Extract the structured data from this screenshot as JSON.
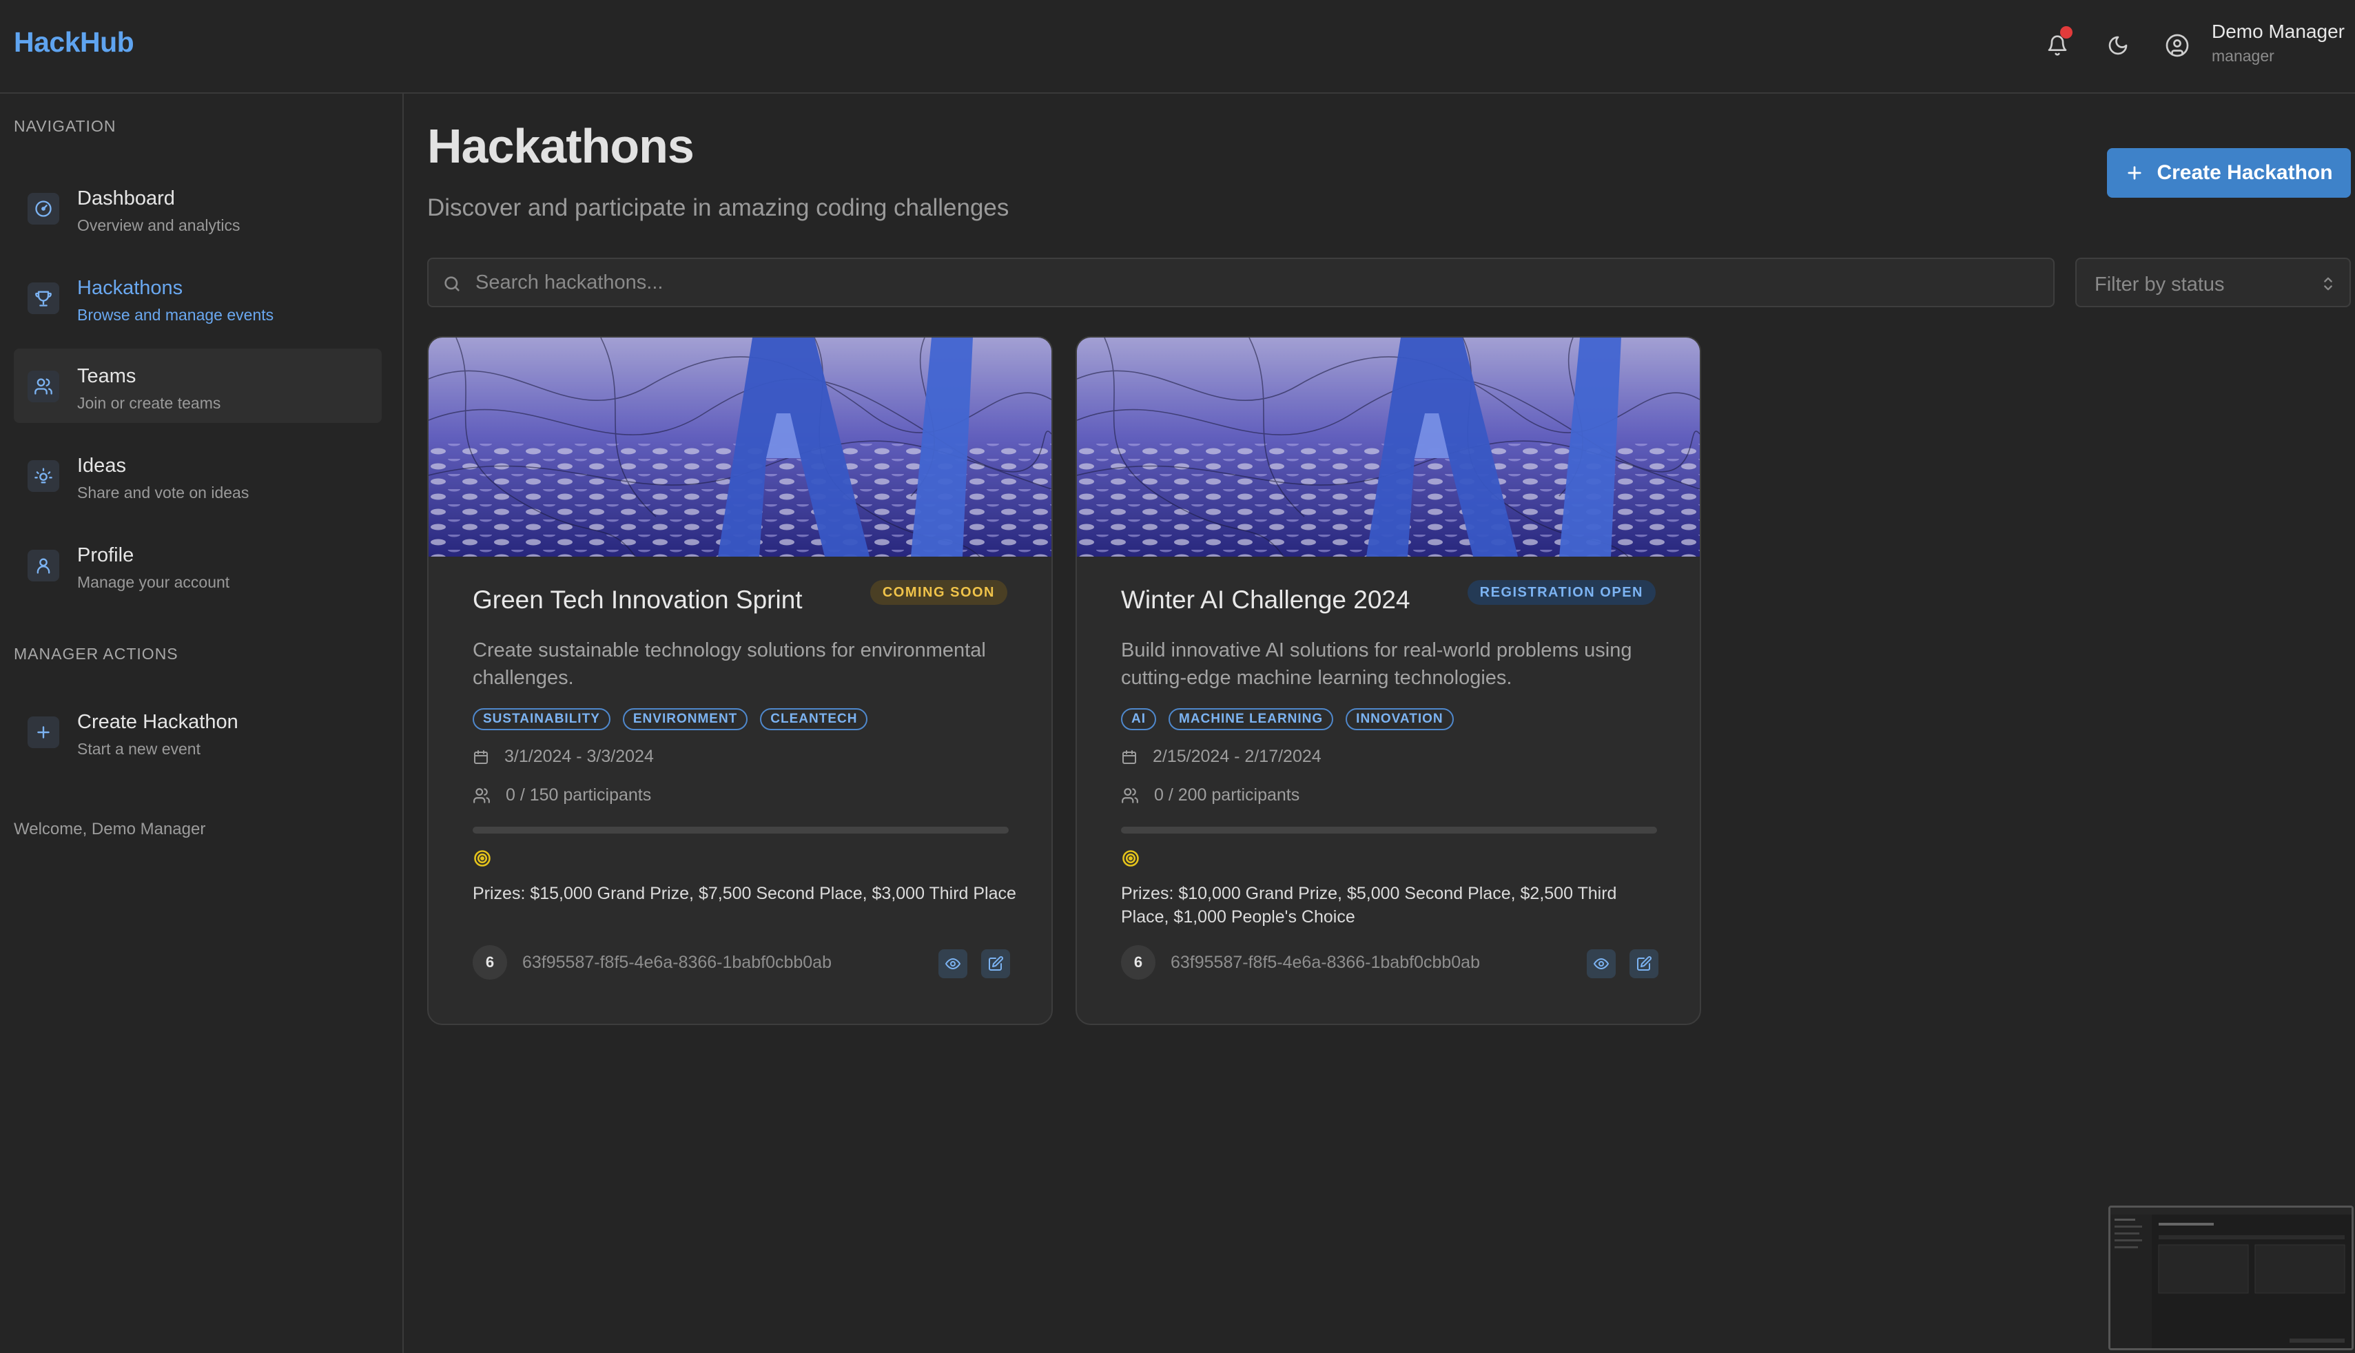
{
  "app": {
    "brand": "HackHub"
  },
  "header": {
    "user_name": "Demo Manager",
    "user_role": "manager"
  },
  "sidebar": {
    "nav_title": "NAVIGATION",
    "items": [
      {
        "label": "Dashboard",
        "sub": "Overview and analytics",
        "icon": "dashboard-icon"
      },
      {
        "label": "Hackathons",
        "sub": "Browse and manage events",
        "icon": "trophy-icon"
      },
      {
        "label": "Teams",
        "sub": "Join or create teams",
        "icon": "users-icon"
      },
      {
        "label": "Ideas",
        "sub": "Share and vote on ideas",
        "icon": "lightbulb-icon"
      },
      {
        "label": "Profile",
        "sub": "Manage your account",
        "icon": "user-icon"
      }
    ],
    "manager_title": "MANAGER ACTIONS",
    "manager_items": [
      {
        "label": "Create Hackathon",
        "sub": "Start a new event",
        "icon": "plus-icon"
      }
    ],
    "welcome": "Welcome, Demo Manager"
  },
  "main": {
    "title": "Hackathons",
    "subtitle": "Discover and participate in amazing coding challenges",
    "create_label": "Create Hackathon",
    "search_placeholder": "Search hackathons...",
    "filter_placeholder": "Filter by status"
  },
  "cards": [
    {
      "title": "Green Tech Innovation Sprint",
      "status": "COMING SOON",
      "description": "Create sustainable technology solutions for environmental challenges.",
      "tags": [
        "SUSTAINABILITY",
        "ENVIRONMENT",
        "CLEANTECH"
      ],
      "dates": "3/1/2024 - 3/3/2024",
      "participants": "0 / 150 participants",
      "progress": 0,
      "prizes": "Prizes: $15,000 Grand Prize, $7,500 Second Place, $3,000 Third Place",
      "count": "6",
      "id": "63f95587-f8f5-4e6a-8366-1babf0cbb0ab"
    },
    {
      "title": "Winter AI Challenge 2024",
      "status": "REGISTRATION OPEN",
      "description": "Build innovative AI solutions for real-world problems using cutting-edge machine learning technologies.",
      "tags": [
        "AI",
        "MACHINE LEARNING",
        "INNOVATION"
      ],
      "dates": "2/15/2024 - 2/17/2024",
      "participants": "0 / 200 participants",
      "progress": 0,
      "prizes": "Prizes: $10,000 Grand Prize, $5,000 Second Place, $2,500 Third Place, $1,000 People's Choice",
      "count": "6",
      "id": "63f95587-f8f5-4e6a-8366-1babf0cbb0ab"
    }
  ],
  "colors": {
    "accent": "#3e82c9",
    "brand": "#5fa4f0",
    "background": "#252525",
    "soon": "#f0c34a",
    "open": "#7cb3f2"
  }
}
